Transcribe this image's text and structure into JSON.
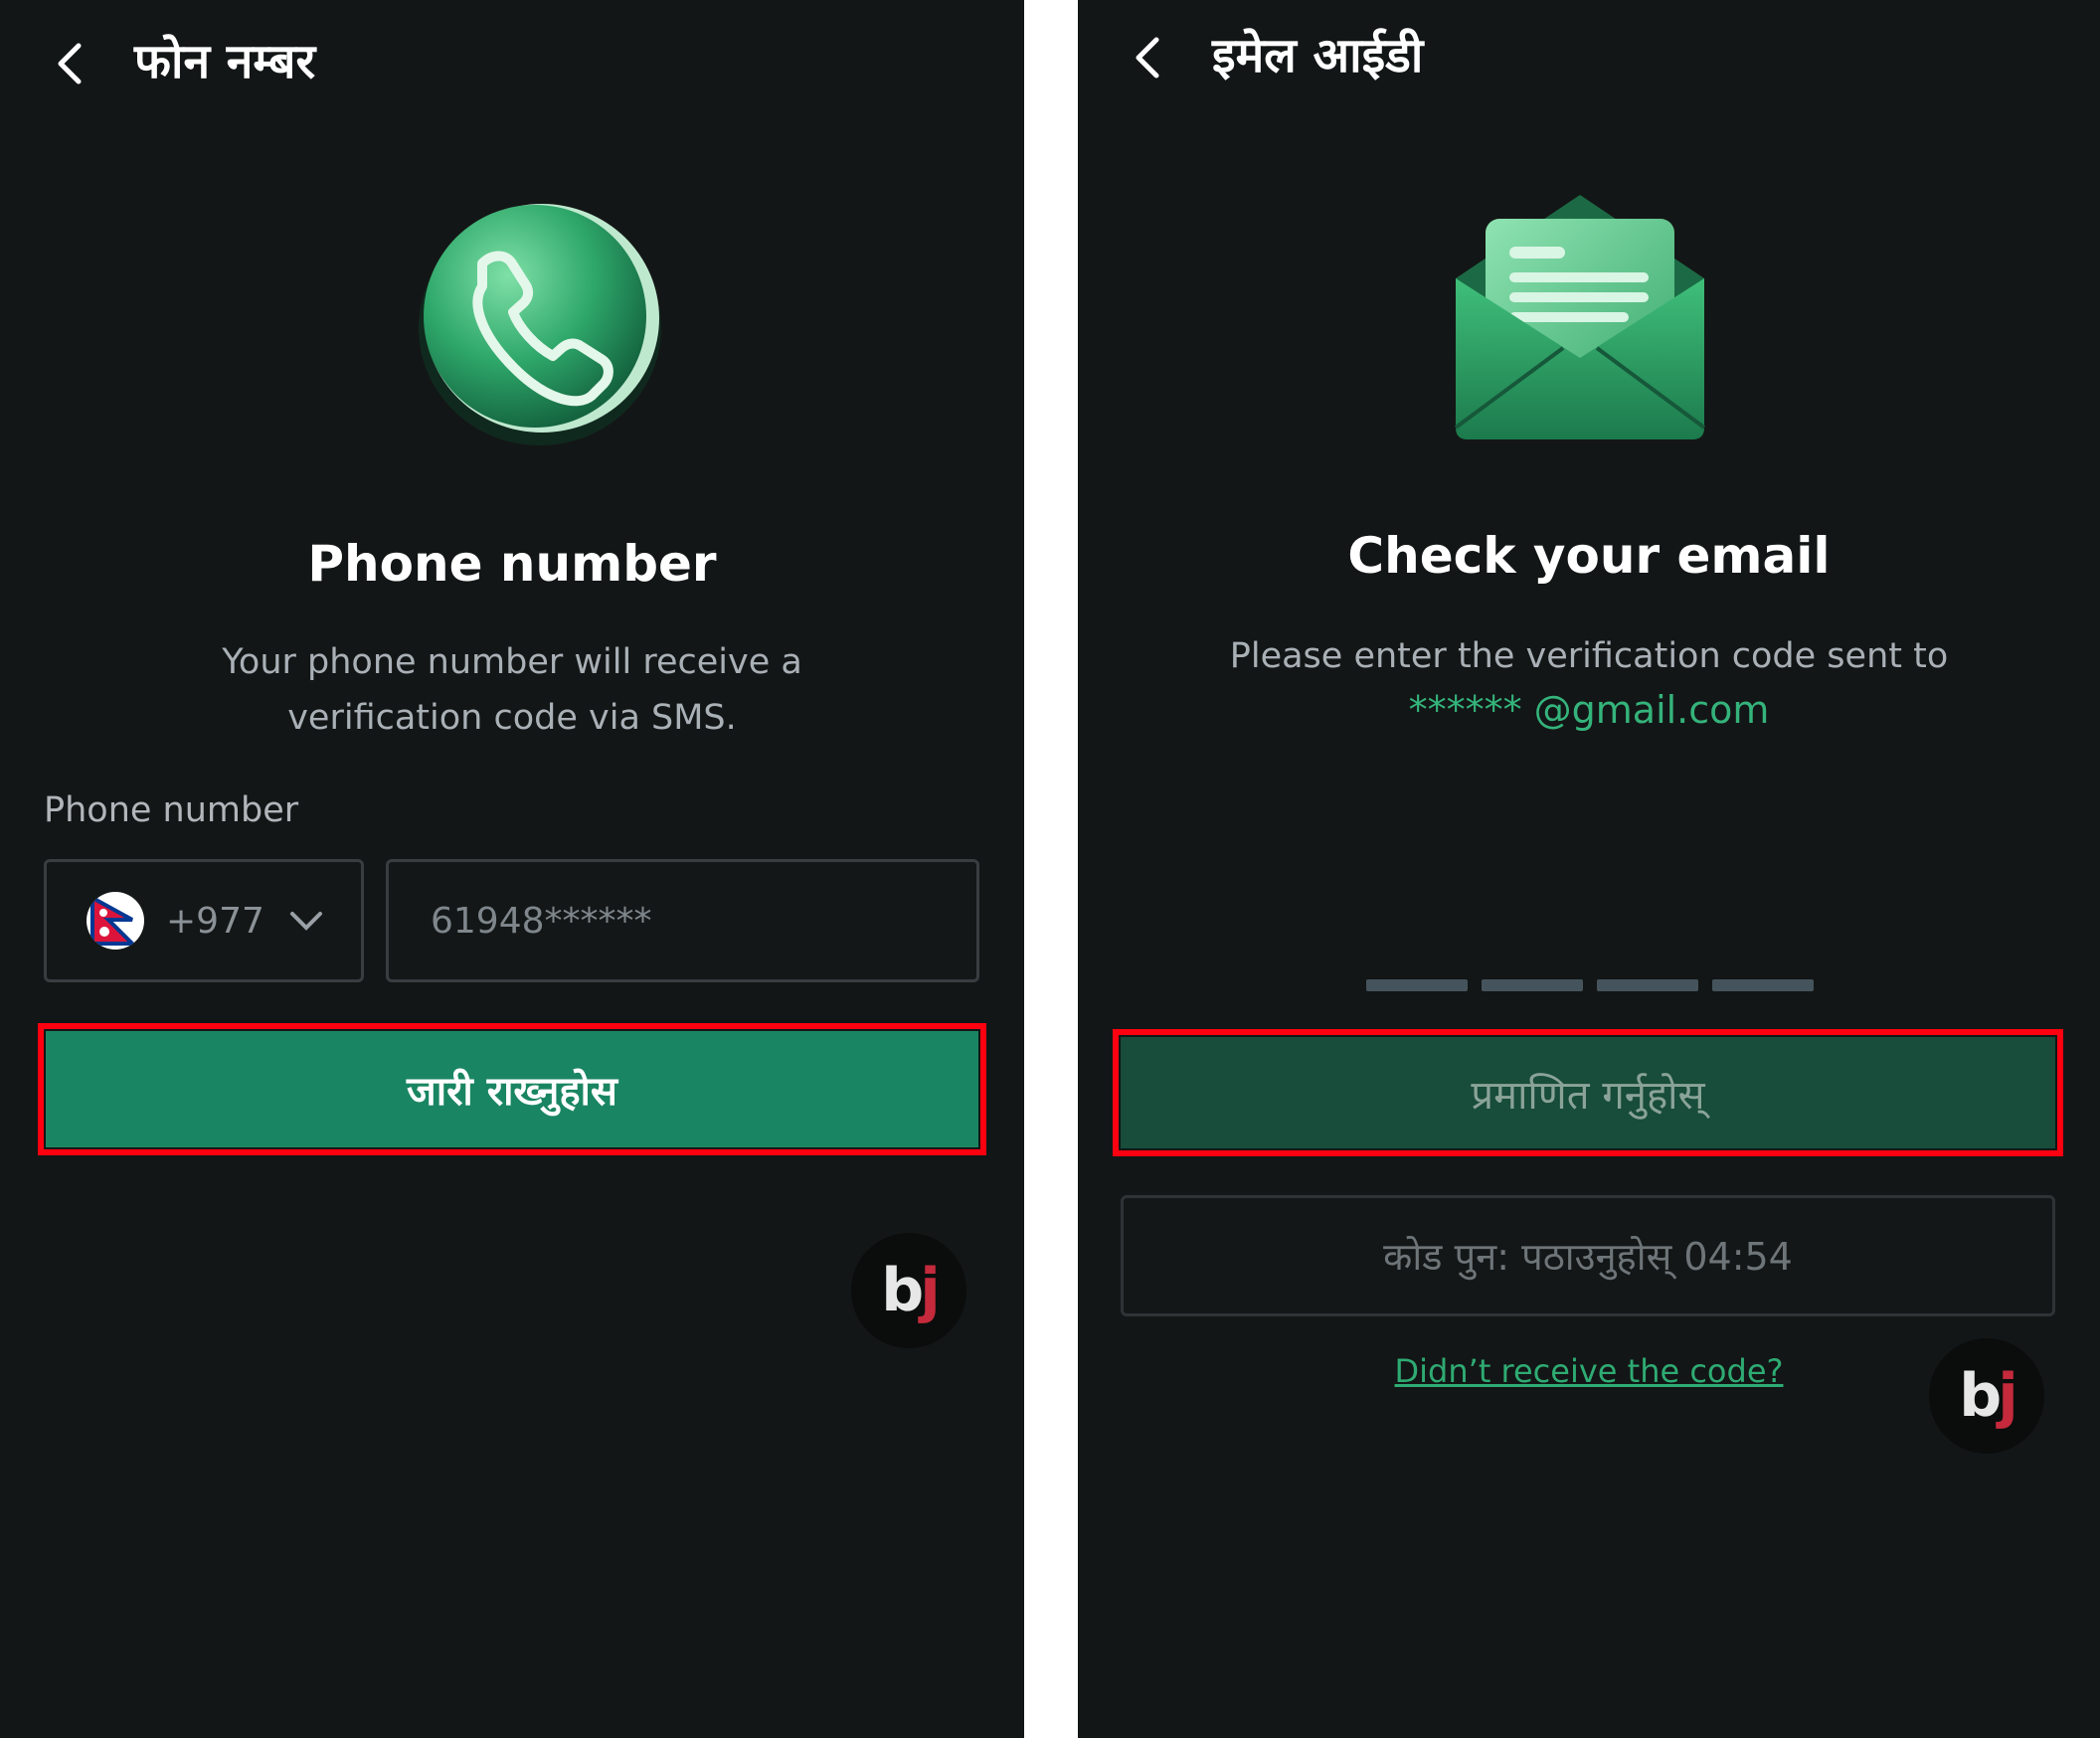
{
  "phone_screen": {
    "header_title": "फोन नम्बर",
    "title": "Phone number",
    "description_line1": "Your phone number will receive a",
    "description_line2": "verification code via SMS.",
    "field_label": "Phone number",
    "country_code": "+977",
    "phone_value": "61948******",
    "continue_label": "जारी राख्नुहोस",
    "icons": [
      "back-arrow-icon",
      "phone-icon",
      "nepal-flag-icon",
      "chevron-down-icon",
      "bj-logo"
    ]
  },
  "email_screen": {
    "header_title": "इमेल आईडी",
    "title": "Check your email",
    "description": "Please enter the verification code sent to",
    "email": "****** @gmail.com",
    "code_digits": 4,
    "verify_label": "प्रमाणित गर्नुहोस्",
    "resend_label": "कोड पुन: पठाउनुहोस् 04:54",
    "help_link": "Didn’t receive the code?",
    "icons": [
      "back-arrow-icon",
      "envelope-icon",
      "bj-logo"
    ]
  },
  "colors": {
    "background": "#131616",
    "accent": "#1a8562",
    "highlight": "#ff0010",
    "link": "#2eab73"
  }
}
